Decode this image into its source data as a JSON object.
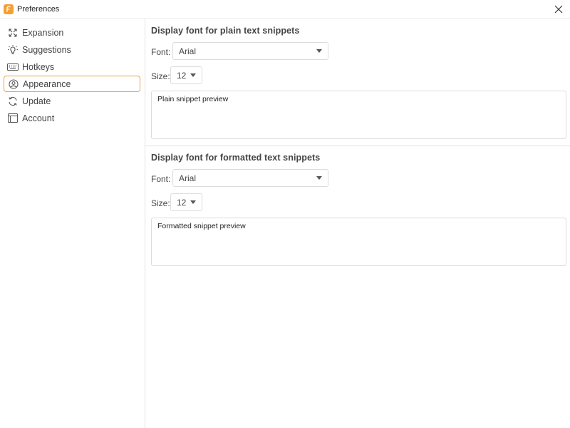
{
  "window": {
    "title": "Preferences"
  },
  "sidebar": {
    "items": [
      {
        "label": "Expansion",
        "icon": "expand-arrows-icon"
      },
      {
        "label": "Suggestions",
        "icon": "lightbulb-icon"
      },
      {
        "label": "Hotkeys",
        "icon": "keyboard-icon"
      },
      {
        "label": "Appearance",
        "icon": "user-circle-icon",
        "active": true
      },
      {
        "label": "Update",
        "icon": "refresh-icon"
      },
      {
        "label": "Account",
        "icon": "account-card-icon"
      }
    ]
  },
  "plain": {
    "title": "Display font for plain text snippets",
    "font_label": "Font:",
    "font_value": "Arial",
    "size_label": "Size:",
    "size_value": "12",
    "preview_text": "Plain snippet preview"
  },
  "formatted": {
    "title": "Display font for formatted text snippets",
    "font_label": "Font:",
    "font_value": "Arial",
    "size_label": "Size:",
    "size_value": "12",
    "preview_text": "Formatted snippet preview"
  },
  "colors": {
    "accent": "#f0a24a",
    "app_icon": "#f5a033",
    "border": "#dcdcdc"
  }
}
